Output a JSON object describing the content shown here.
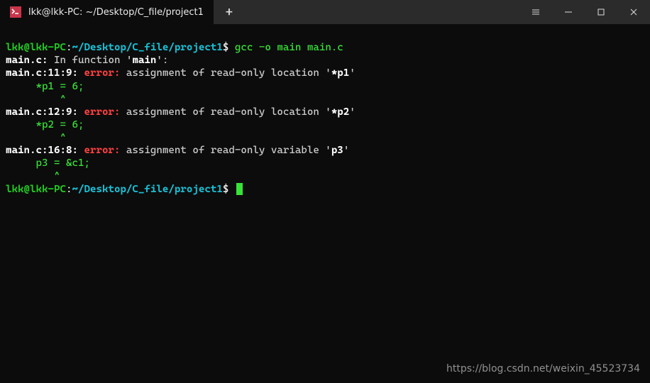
{
  "titlebar": {
    "tab_title": "lkk@lkk-PC: ~/Desktop/C_file/project1",
    "newtab_glyph": "+"
  },
  "prompt1": {
    "user": "lkk@lkk-PC",
    "colon": ":",
    "path": "~/Desktop/C_file/project1",
    "dollar": "$",
    "command": " gcc -o main main.c"
  },
  "err_intro": {
    "file": "main.c:",
    "msg": " In function '",
    "fn": "main",
    "msg2": "':"
  },
  "error1": {
    "loc": "main.c:11:9:",
    "tag": " error:",
    "msg": " assignment of read-only location '",
    "hl": "*p1",
    "msg2": "'",
    "code": "     *p1 = 6;",
    "caret": "         ^"
  },
  "error2": {
    "loc": "main.c:12:9:",
    "tag": " error:",
    "msg": " assignment of read-only location '",
    "hl": "*p2",
    "msg2": "'",
    "code": "     *p2 = 6;",
    "caret": "         ^"
  },
  "error3": {
    "loc": "main.c:16:8:",
    "tag": " error:",
    "msg": " assignment of read-only variable '",
    "hl": "p3",
    "msg2": "'",
    "code": "     p3 = &c1;",
    "caret": "        ^"
  },
  "prompt2": {
    "user": "lkk@lkk-PC",
    "colon": ":",
    "path": "~/Desktop/C_file/project1",
    "dollar": "$"
  },
  "watermark": "https://blog.csdn.net/weixin_45523734"
}
